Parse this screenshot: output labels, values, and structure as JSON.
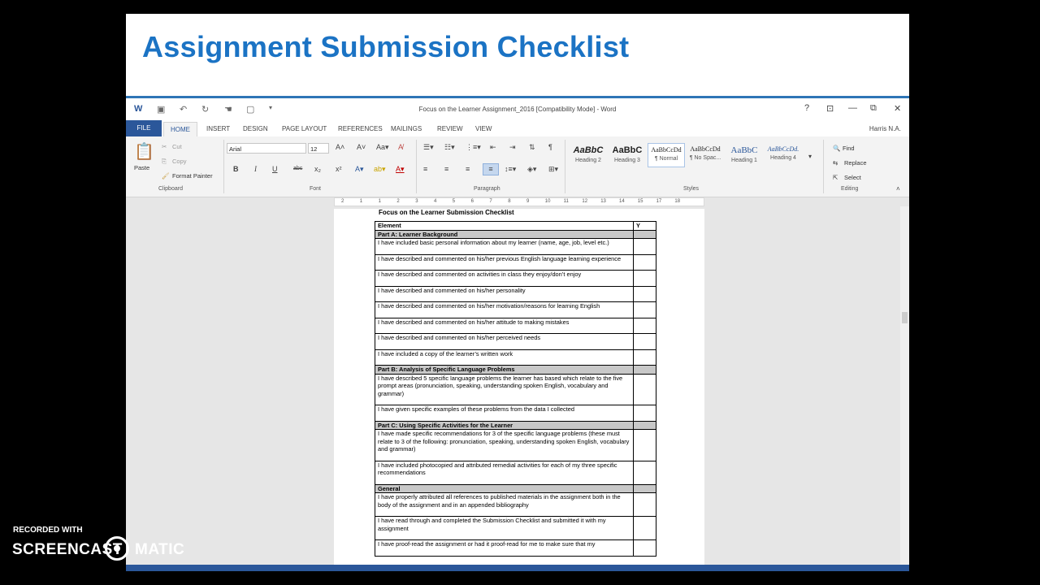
{
  "slide": {
    "title": "Assignment Submission Checklist"
  },
  "word": {
    "window_title": "Focus on the Learner Assignment_2016 [Compatibility Mode] - Word",
    "user": "Harris N.A.",
    "tabs": [
      "FILE",
      "HOME",
      "INSERT",
      "DESIGN",
      "PAGE LAYOUT",
      "REFERENCES",
      "MAILINGS",
      "REVIEW",
      "VIEW"
    ],
    "window_buttons": {
      "help": "?",
      "minimize": "—",
      "restore": "⧉",
      "close": "✕"
    },
    "clipboard": {
      "paste": "Paste",
      "cut": "Cut",
      "copy": "Copy",
      "format_painter": "Format Painter",
      "label": "Clipboard"
    },
    "font": {
      "name": "Arial",
      "size": "12",
      "bold": "B",
      "italic": "I",
      "underline": "U",
      "strikethrough": "abc",
      "subscript": "x₂",
      "superscript": "x²",
      "label": "Font"
    },
    "paragraph": {
      "label": "Paragraph"
    },
    "styles": {
      "items": [
        {
          "sample": "AaBbC",
          "name": "Heading 2"
        },
        {
          "sample": "AaBbC",
          "name": "Heading 3"
        },
        {
          "sample": "AaBbCcDd",
          "name": "¶ Normal"
        },
        {
          "sample": "AaBbCcDd",
          "name": "¶ No Spac..."
        },
        {
          "sample": "AaBbC",
          "name": "Heading 1"
        },
        {
          "sample": "AaBbCcDd.",
          "name": "Heading 4"
        }
      ],
      "label": "Styles"
    },
    "editing": {
      "find": "Find",
      "replace": "Replace",
      "select": "Select",
      "label": "Editing"
    },
    "ruler": [
      "2",
      "1",
      "1",
      "2",
      "3",
      "4",
      "5",
      "6",
      "7",
      "8",
      "9",
      "10",
      "11",
      "12",
      "13",
      "14",
      "15",
      "17",
      "18"
    ],
    "document": {
      "heading": "Focus on the Learner Submission Checklist",
      "header_row": {
        "element": "Element",
        "y": "Y"
      },
      "rows": [
        {
          "type": "section",
          "text": "Part A: Learner Background"
        },
        {
          "type": "item",
          "text": "I have included basic personal information about my learner (name, age, job, level etc.)"
        },
        {
          "type": "item",
          "text": "I have described and commented on his/her previous English language learning experience"
        },
        {
          "type": "item",
          "text": "I have described and commented on activities in class they enjoy/don’t enjoy"
        },
        {
          "type": "item",
          "text": "I have described and commented on his/her personality"
        },
        {
          "type": "item",
          "text": "I have described and commented on his/her motivation/reasons for learning English"
        },
        {
          "type": "item",
          "text": "I have described and commented on his/her attitude to making mistakes"
        },
        {
          "type": "item",
          "text": "I have described and commented on his/her perceived needs"
        },
        {
          "type": "item",
          "text": "I have included a copy of the learner’s written work"
        },
        {
          "type": "section",
          "text": "Part B: Analysis of Specific Language Problems"
        },
        {
          "type": "item",
          "text": "I have described 5 specific language problems the learner has based which relate to the five prompt areas (pronunciation, speaking, understanding spoken English, vocabulary and grammar)"
        },
        {
          "type": "item",
          "text": "I have given specific examples of these problems from the data I collected"
        },
        {
          "type": "section",
          "text": "Part C: Using Specific Activities for the Learner"
        },
        {
          "type": "item",
          "text": "I have made specific recommendations for 3 of the specific language problems (these must relate to 3 of the following: pronunciation, speaking, understanding spoken English, vocabulary and grammar)"
        },
        {
          "type": "item",
          "text": "I have included photocopied and attributed remedial activities  for each of my three specific recommendations"
        },
        {
          "type": "section",
          "text": "General"
        },
        {
          "type": "item",
          "text": "I have properly attributed all references to published materials in the assignment both in the body of the assignment and in an appended bibliography"
        },
        {
          "type": "item",
          "text": "I have read through and completed the Submission Checklist and submitted it with my assignment"
        },
        {
          "type": "item",
          "text": "I have proof-read the assignment or had it proof-read for me to make sure that my"
        }
      ]
    }
  },
  "watermark": {
    "recorded_with": "RECORDED WITH",
    "brand_left": "SCREENCAST",
    "brand_right": "MATIC"
  }
}
